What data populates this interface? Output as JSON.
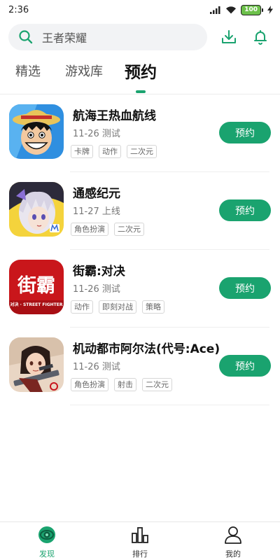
{
  "status_bar": {
    "time": "2:36",
    "battery": "100"
  },
  "search": {
    "placeholder_text": "王者荣耀"
  },
  "header_icons": [
    "download-icon",
    "bell-icon"
  ],
  "tabs": [
    {
      "label": "精选",
      "active": false
    },
    {
      "label": "游戏库",
      "active": false
    },
    {
      "label": "预约",
      "active": true
    }
  ],
  "games": [
    {
      "title": "航海王热血航线",
      "date": "11-26 测试",
      "tags": [
        "卡牌",
        "动作",
        "二次元"
      ],
      "button": "预约"
    },
    {
      "title": "通感纪元",
      "date": "11-27 上线",
      "tags": [
        "角色扮演",
        "二次元"
      ],
      "button": "预约"
    },
    {
      "title": "街霸:对决",
      "date": "11-26 测试",
      "tags": [
        "动作",
        "即刻对战",
        "策略"
      ],
      "button": "预约",
      "icon_text": "街霸",
      "icon_subtext": "对决 · STREET FIGHTER"
    },
    {
      "title": "机动都市阿尔法(代号:Ace)",
      "date": "11-26 测试",
      "tags": [
        "角色扮演",
        "射击",
        "二次元"
      ],
      "button": "预约"
    }
  ],
  "bottom_nav": [
    {
      "label": "发现",
      "icon": "discover-icon",
      "active": true
    },
    {
      "label": "排行",
      "icon": "ranking-icon",
      "active": false
    },
    {
      "label": "我的",
      "icon": "profile-icon",
      "active": false
    }
  ],
  "colors": {
    "accent": "#1aa36f",
    "battery": "#6cc04a"
  }
}
